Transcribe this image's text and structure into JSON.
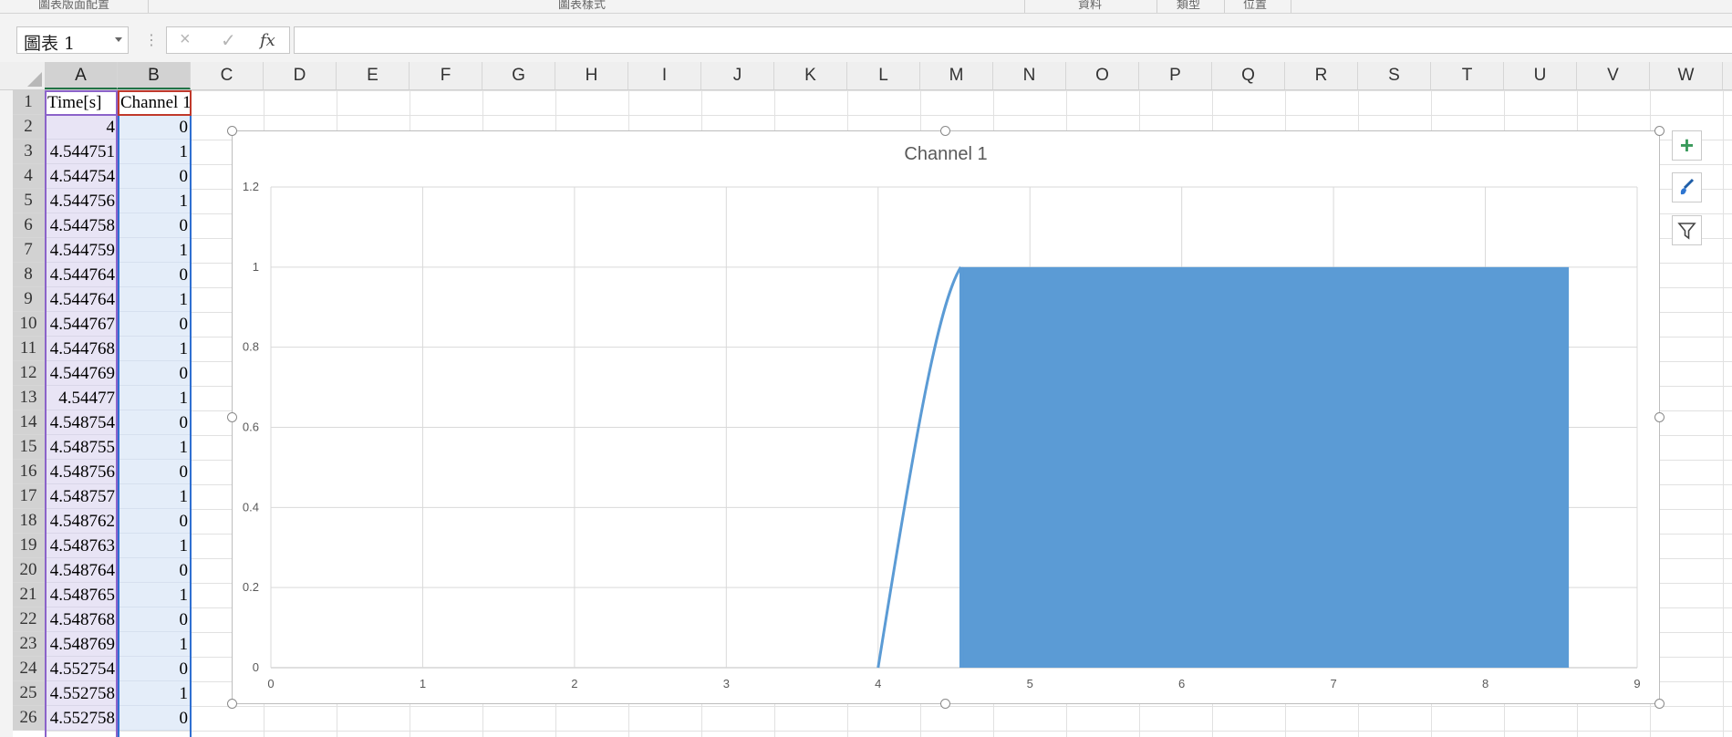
{
  "ribbon": {
    "groups": [
      "圖表版面配置",
      "圖表樣式",
      "資料",
      "類型",
      "位置"
    ]
  },
  "formula_bar": {
    "name_box": "圖表 1",
    "cancel_icon": "×",
    "enter_icon": "✓",
    "fx_label": "fx",
    "formula": ""
  },
  "columns": [
    "A",
    "B",
    "C",
    "D",
    "E",
    "F",
    "G",
    "H",
    "I",
    "J",
    "K",
    "L",
    "M",
    "N",
    "O",
    "P",
    "Q",
    "R",
    "S",
    "T",
    "U",
    "V",
    "W"
  ],
  "rows": [
    "1",
    "2",
    "3",
    "4",
    "5",
    "6",
    "7",
    "8",
    "9",
    "10",
    "11",
    "12",
    "13",
    "14",
    "15",
    "16",
    "17",
    "18",
    "19",
    "20",
    "21",
    "22",
    "23",
    "24",
    "25",
    "26"
  ],
  "sheet": {
    "header": {
      "a": "Time[s]",
      "b": "Channel 1"
    },
    "data": [
      {
        "a": "4",
        "b": "0"
      },
      {
        "a": "4.544751",
        "b": "1"
      },
      {
        "a": "4.544754",
        "b": "0"
      },
      {
        "a": "4.544756",
        "b": "1"
      },
      {
        "a": "4.544758",
        "b": "0"
      },
      {
        "a": "4.544759",
        "b": "1"
      },
      {
        "a": "4.544764",
        "b": "0"
      },
      {
        "a": "4.544764",
        "b": "1"
      },
      {
        "a": "4.544767",
        "b": "0"
      },
      {
        "a": "4.544768",
        "b": "1"
      },
      {
        "a": "4.544769",
        "b": "0"
      },
      {
        "a": "4.54477",
        "b": "1"
      },
      {
        "a": "4.548754",
        "b": "0"
      },
      {
        "a": "4.548755",
        "b": "1"
      },
      {
        "a": "4.548756",
        "b": "0"
      },
      {
        "a": "4.548757",
        "b": "1"
      },
      {
        "a": "4.548762",
        "b": "0"
      },
      {
        "a": "4.548763",
        "b": "1"
      },
      {
        "a": "4.548764",
        "b": "0"
      },
      {
        "a": "4.548765",
        "b": "1"
      },
      {
        "a": "4.548768",
        "b": "0"
      },
      {
        "a": "4.548769",
        "b": "1"
      },
      {
        "a": "4.552754",
        "b": "0"
      },
      {
        "a": "4.552758",
        "b": "1"
      },
      {
        "a": "4.552758",
        "b": "0"
      }
    ]
  },
  "chart_buttons": {
    "add_icon": "+",
    "style_icon": "paintbrush",
    "filter_icon": "funnel"
  },
  "chart_data": {
    "type": "line",
    "title": "Channel 1",
    "xlabel": "",
    "ylabel": "",
    "xlim": [
      0,
      9
    ],
    "ylim": [
      0,
      1.2
    ],
    "x_ticks": [
      "0",
      "1",
      "2",
      "3",
      "4",
      "5",
      "6",
      "7",
      "8",
      "9"
    ],
    "y_ticks": [
      "0",
      "0.2",
      "0.4",
      "0.6",
      "0.8",
      "1",
      "1.2"
    ],
    "grid": true,
    "legend": false,
    "line_color": "#5b9bd5",
    "series": [
      {
        "x": [
          4,
          4.544751,
          4.544754,
          4.544756,
          4.544758,
          4.544759,
          4.544764,
          4.544764,
          4.544767,
          4.544768,
          4.544769,
          4.54477,
          4.548754,
          4.548755,
          4.548756,
          4.548757,
          4.548762,
          4.548763,
          4.548764,
          4.548765,
          4.548768,
          4.548769,
          4.552754,
          4.552758,
          4.552758
        ],
        "values": [
          0,
          1,
          0,
          1,
          0,
          1,
          0,
          1,
          0,
          1,
          0,
          1,
          0,
          1,
          0,
          1,
          0,
          1,
          0,
          1,
          0,
          1,
          0,
          1,
          0
        ]
      }
    ],
    "dense_fill": {
      "x_from": 4.55,
      "x_to": 8.55,
      "y_from": 0,
      "y_to": 1
    }
  }
}
